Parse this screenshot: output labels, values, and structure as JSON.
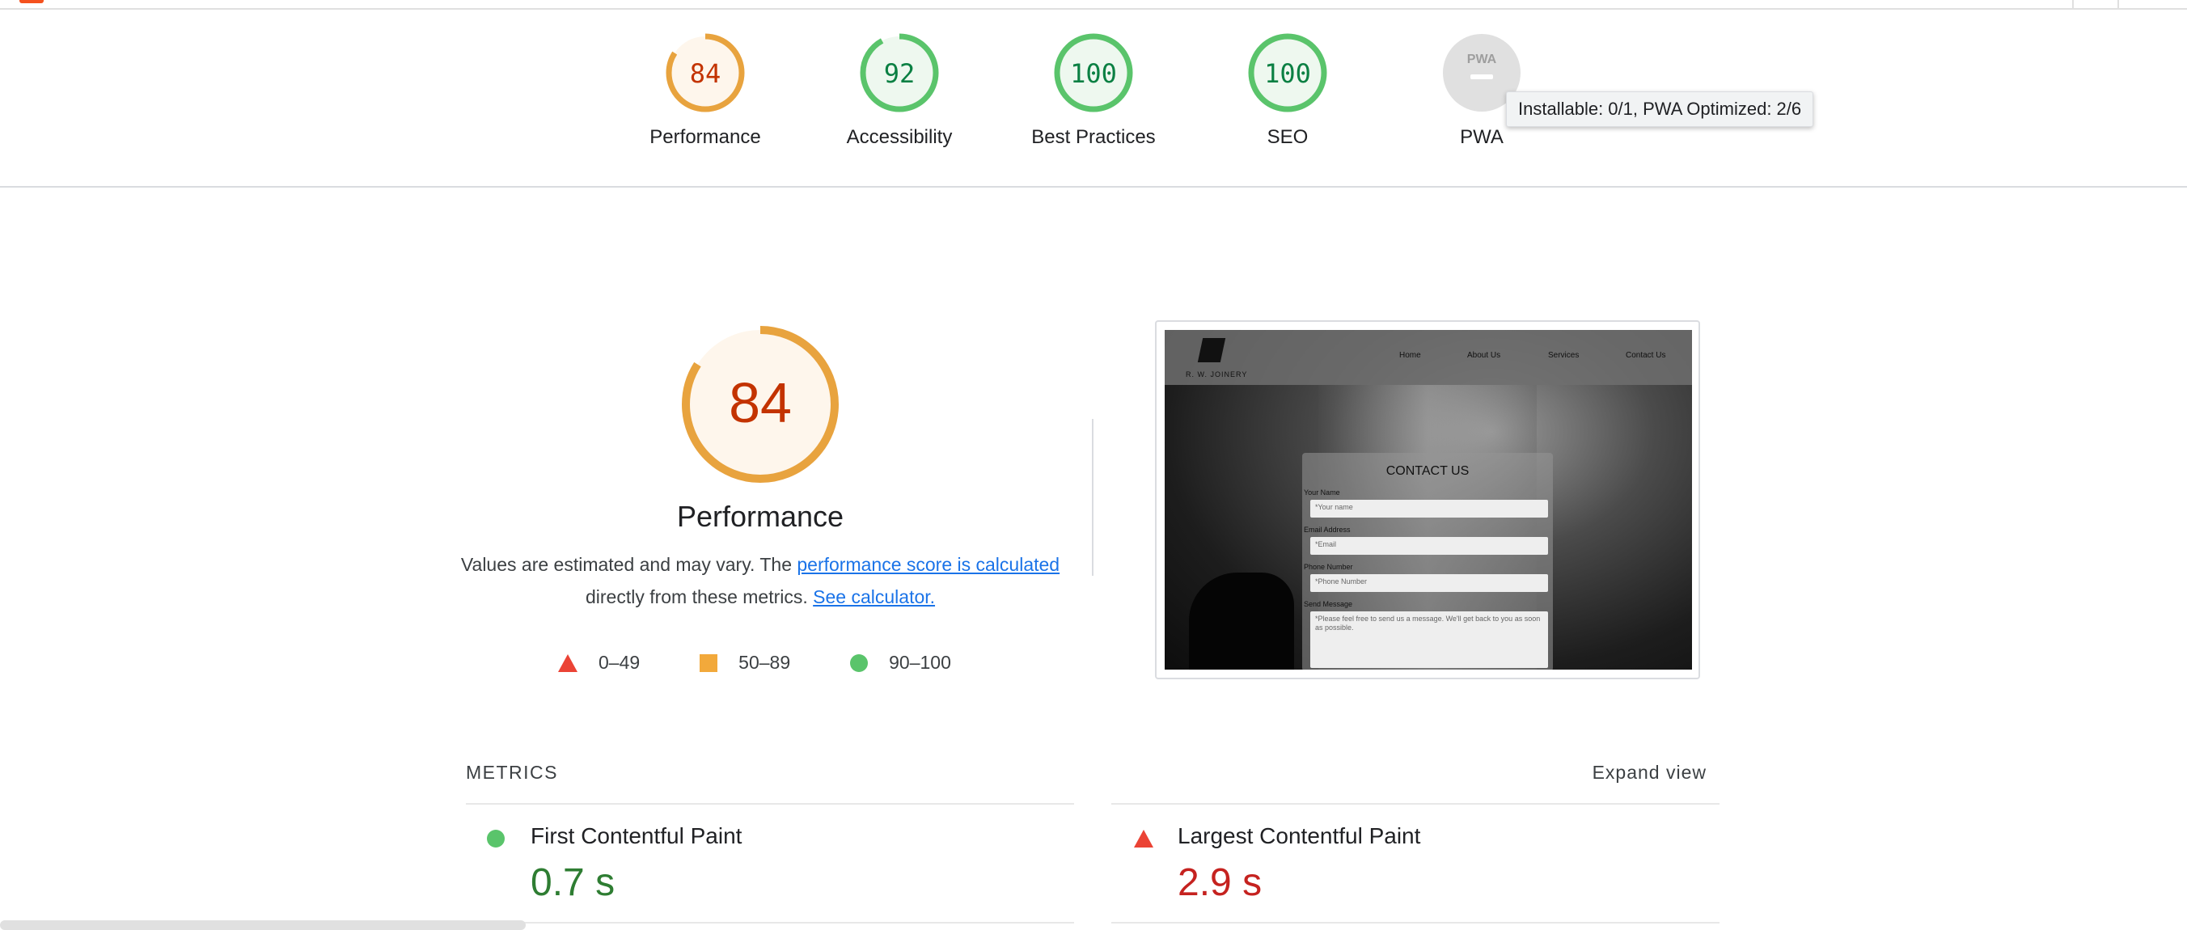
{
  "colors": {
    "average": "#e8a33e",
    "average_text": "#c33300",
    "pass": "#5ac46b",
    "pass_text": "#0b8043",
    "fail": "#eb4335",
    "fail_text": "#c5221f",
    "neutral": "#e0e0e0",
    "link": "#1a73e8"
  },
  "summary": {
    "gauges": [
      {
        "score": "84",
        "label": "Performance",
        "fraction": 0.84,
        "status": "average"
      },
      {
        "score": "92",
        "label": "Accessibility",
        "fraction": 0.92,
        "status": "pass"
      },
      {
        "score": "100",
        "label": "Best Practices",
        "fraction": 1.0,
        "status": "pass"
      },
      {
        "score": "100",
        "label": "SEO",
        "fraction": 1.0,
        "status": "pass"
      },
      {
        "score": "PWA",
        "label": "PWA",
        "fraction": 0,
        "status": "neutral"
      }
    ],
    "pwa_tooltip": "Installable: 0/1, PWA Optimized: 2/6"
  },
  "performance": {
    "score": "84",
    "fraction": 0.84,
    "title": "Performance",
    "desc_prefix": "Values are estimated and may vary. The ",
    "desc_link": "performance score is calculated",
    "desc_middle": " directly from these metrics. ",
    "calc_link": "See calculator.",
    "legend": [
      {
        "range": "0–49",
        "icon": "red-triangle-icon"
      },
      {
        "range": "50–89",
        "icon": "orange-square-icon"
      },
      {
        "range": "90–100",
        "icon": "green-circle-icon"
      }
    ]
  },
  "screenshot": {
    "brand": "R. W. JOINERY",
    "nav": [
      "Home",
      "About Us",
      "Services",
      "Contact Us"
    ],
    "heading": "CONTACT US",
    "fields": [
      {
        "label": "Your Name",
        "placeholder": "*Your name"
      },
      {
        "label": "Email Address",
        "placeholder": "*Email"
      },
      {
        "label": "Phone Number",
        "placeholder": "*Phone Number"
      },
      {
        "label": "Send Message",
        "placeholder": "*Please feel free to send us a message. We'll get back to you as soon as possible."
      }
    ]
  },
  "metrics": {
    "header": "METRICS",
    "expand": "Expand view",
    "items": [
      {
        "name": "First Contentful Paint",
        "value": "0.7 s",
        "status": "pass"
      },
      {
        "name": "Largest Contentful Paint",
        "value": "2.9 s",
        "status": "fail"
      }
    ]
  }
}
